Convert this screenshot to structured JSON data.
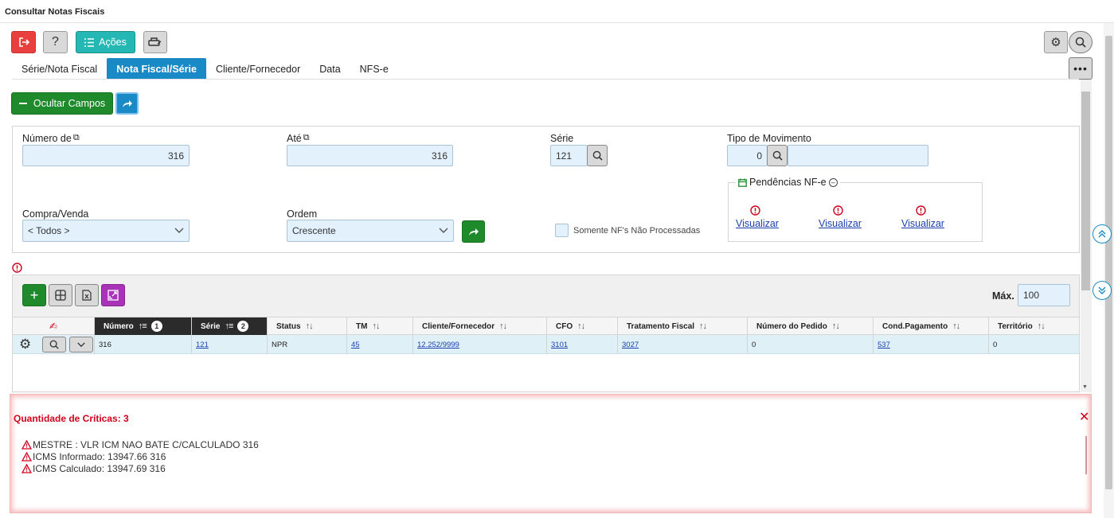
{
  "window": {
    "title": "Consultar Notas Fiscais"
  },
  "toolbar": {
    "acoes_label": "Ações",
    "help_label": "?"
  },
  "tabs": [
    "Série/Nota Fiscal",
    "Nota Fiscal/Série",
    "Cliente/Fornecedor",
    "Data",
    "NFS-e"
  ],
  "active_tab": "Nota Fiscal/Série",
  "actions": {
    "ocultar_label": "Ocultar Campos"
  },
  "form": {
    "numero_de": {
      "label": "Número de",
      "value": "316"
    },
    "ate": {
      "label": "Até",
      "value": "316"
    },
    "serie": {
      "label": "Série",
      "value": "121"
    },
    "tipo_movimento": {
      "label": "Tipo de Movimento",
      "value": "0",
      "desc": ""
    },
    "compra_venda": {
      "label": "Compra/Venda",
      "value": "< Todos >"
    },
    "ordem": {
      "label": "Ordem",
      "value": "Crescente"
    },
    "somente_label": "Somente NF's Não Processadas"
  },
  "pendencias": {
    "title": "Pendências NF-e",
    "items": [
      "Visualizar",
      "Visualizar",
      "Visualizar"
    ]
  },
  "grid": {
    "max_label": "Máx.",
    "max_value": "100",
    "columns": [
      "Número",
      "Série",
      "Status",
      "TM",
      "Cliente/Fornecedor",
      "CFO",
      "Tratamento Fiscal",
      "Número do Pedido",
      "Cond.Pagamento",
      "Território"
    ],
    "sort_badges": [
      "1",
      "2"
    ],
    "rows": [
      {
        "numero": "316",
        "serie": "121",
        "status": "NPR",
        "tm": "45",
        "cliente": "12.252/9999",
        "cfo": "3101",
        "tratamento": "3027",
        "pedido": "0",
        "cond_pagamento": "537",
        "territorio": "0"
      }
    ]
  },
  "criticas": {
    "title": "Quantidade de Críticas: 3",
    "lines": [
      "MESTRE : VLR ICM NAO BATE C/CALCULADO 316",
      "ICMS Informado: 13947.66 316",
      "ICMS Calculado: 13947.69 316"
    ]
  },
  "colors": {
    "accent": "#1a8ac7",
    "green": "#1f8a2c",
    "teal": "#25b7b3",
    "danger": "#e8403f",
    "critical_red": "#d0021b"
  }
}
